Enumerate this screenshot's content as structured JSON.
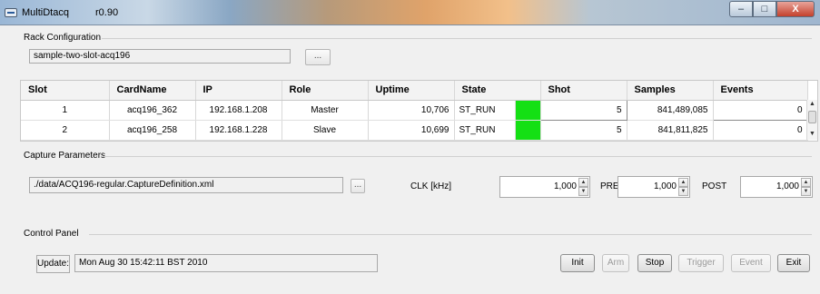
{
  "window": {
    "title": "MultiDtacq",
    "version": "r0.90",
    "controls": {
      "minimize": "–",
      "maximize": "□",
      "close": "X"
    }
  },
  "rack": {
    "group_title": "Rack Configuration",
    "config_value": "sample-two-slot-acq196",
    "browse_label": "..."
  },
  "table": {
    "columns": [
      "Slot",
      "CardName",
      "IP",
      "Role",
      "Uptime",
      "State",
      "Shot",
      "Samples",
      "Events"
    ],
    "rows": [
      {
        "slot": "1",
        "card": "acq196_362",
        "ip": "192.168.1.208",
        "role": "Master",
        "uptime": "10,706",
        "state": "ST_RUN",
        "state_color": "#14e014",
        "shot": "5",
        "samples": "841,489,085",
        "events": "0"
      },
      {
        "slot": "2",
        "card": "acq196_258",
        "ip": "192.168.1.228",
        "role": "Slave",
        "uptime": "10,699",
        "state": "ST_RUN",
        "state_color": "#14e014",
        "shot": "5",
        "samples": "841,811,825",
        "events": "0"
      }
    ]
  },
  "capture": {
    "group_title": "Capture Parameters",
    "definition_file": "./data/ACQ196-regular.CaptureDefinition.xml",
    "browse_label": "...",
    "clk_label": "CLK [kHz]",
    "clk_value": "1,000",
    "pre_label": "PRE",
    "pre_value": "1,000",
    "post_label": "POST",
    "post_value": "1,000"
  },
  "control": {
    "group_title": "Control Panel",
    "update_label": "Update:",
    "update_value": "Mon Aug 30 15:42:11 BST 2010",
    "buttons": {
      "init": "Init",
      "arm": "Arm",
      "stop": "Stop",
      "trigger": "Trigger",
      "event": "Event",
      "exit": "Exit"
    }
  },
  "colors": {
    "state_ok": "#14e014"
  }
}
